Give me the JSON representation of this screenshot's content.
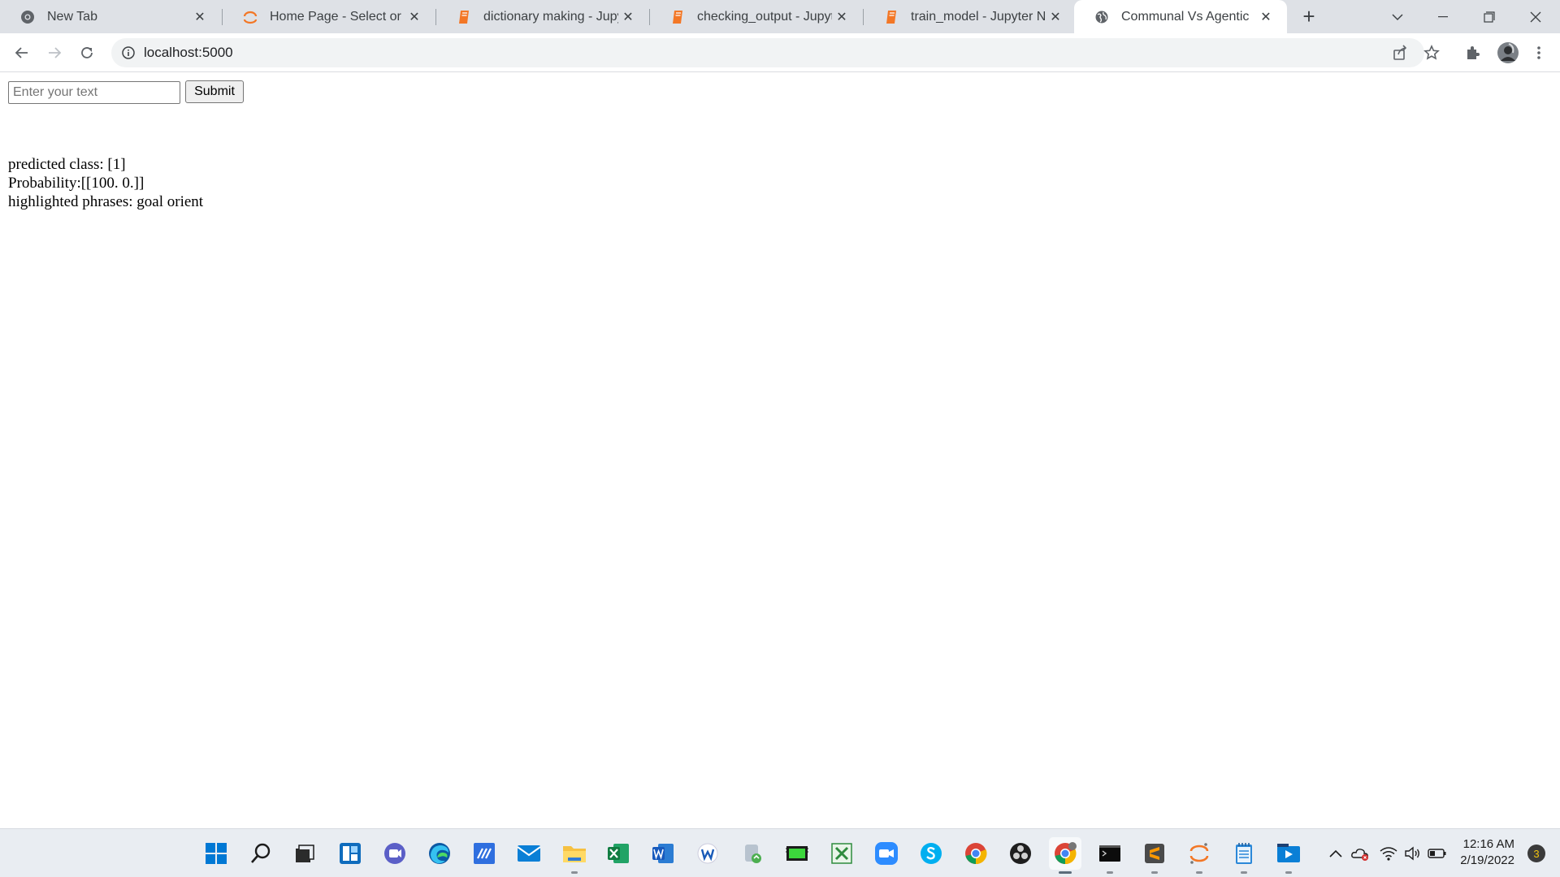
{
  "browser": {
    "tabs": [
      {
        "title": "New Tab",
        "icon": "chrome-icon"
      },
      {
        "title": "Home Page - Select or crea",
        "icon": "jupyter-icon"
      },
      {
        "title": "dictionary making - Jupyter",
        "icon": "jupyter-notebook-icon"
      },
      {
        "title": "checking_output - Jupyter N",
        "icon": "jupyter-notebook-icon"
      },
      {
        "title": "train_model - Jupyter Noteb",
        "icon": "jupyter-notebook-icon"
      },
      {
        "title": "Communal Vs Agentic",
        "icon": "globe-icon",
        "active": true
      }
    ],
    "url": "localhost:5000"
  },
  "page": {
    "input_placeholder": "Enter your text",
    "input_value": "",
    "submit_label": "Submit",
    "results": [
      "predicted class: [1]",
      "Probability:[[100. 0.]]",
      "highlighted phrases: goal orient"
    ]
  },
  "taskbar": {
    "apps": [
      "start-icon",
      "search-icon",
      "task-view-icon",
      "widgets-icon",
      "teams-chat-icon",
      "edge-icon",
      "visual-studio-icon",
      "mail-icon",
      "file-explorer-icon",
      "excel-icon",
      "word-icon",
      "wordweb-icon",
      "backup-icon",
      "gpu-z-icon",
      "excel-csv-icon",
      "zoom-icon",
      "skype-icon",
      "chrome-icon",
      "obs-icon",
      "chrome-profile-icon",
      "terminal-icon",
      "sublime-text-icon",
      "jupyter-icon",
      "notepad-icon",
      "media-player-icon"
    ],
    "clock": {
      "time": "12:16 AM",
      "date": "2/19/2022"
    },
    "notification_count": "3"
  },
  "colors": {
    "tabstrip": "#dee1e6",
    "taskbar": "#e9edf2",
    "accent": "#0067c0"
  }
}
